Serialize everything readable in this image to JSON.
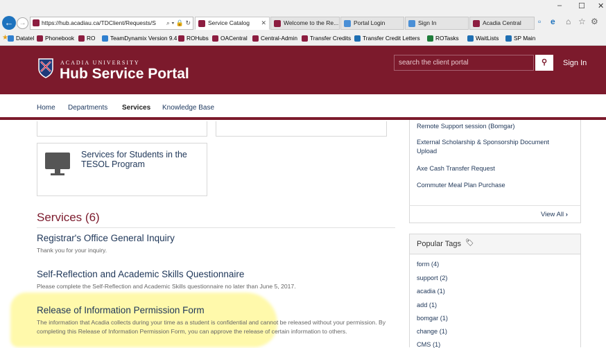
{
  "browser": {
    "url": "https://hub.acadiau.ca/TDClient/Requests/S",
    "tabs": [
      {
        "title": "Service Catalog",
        "icon_color": "#8c1d40",
        "active": true
      },
      {
        "title": "Welcome to the Re...",
        "icon_color": "#8c1d40"
      },
      {
        "title": "Portal Login",
        "icon_color": "#4a8fd6"
      },
      {
        "title": "Sign In",
        "icon_color": "#4a8fd6"
      },
      {
        "title": "Acadia Central",
        "icon_color": "#8c1d40"
      }
    ],
    "favorites": [
      {
        "label": "Datatel",
        "icon_color": "#2f7fcf"
      },
      {
        "label": "Phonebook",
        "icon_color": "#8c1d40"
      },
      {
        "label": "RO",
        "icon_color": "#8c1d40"
      },
      {
        "label": "TeamDynamix Version 9.4",
        "icon_color": "#2f7fcf"
      },
      {
        "label": "ROHubs",
        "icon_color": "#8c1d40"
      },
      {
        "label": "OACentral",
        "icon_color": "#8c1d40"
      },
      {
        "label": "Central-Admin",
        "icon_color": "#8c1d40"
      },
      {
        "label": "Transfer Credits",
        "icon_color": "#8c1d40"
      },
      {
        "label": "Transfer Credit Letters",
        "icon_color": "#1f6fb2"
      },
      {
        "label": "ROTasks",
        "icon_color": "#1e7c3a"
      },
      {
        "label": "WaitLists",
        "icon_color": "#1f6fb2"
      },
      {
        "label": "SP Main",
        "icon_color": "#1f6fb2"
      }
    ]
  },
  "header": {
    "logo_small": "ACADIA UNIVERSITY",
    "logo_big": "Hub Service Portal",
    "search_placeholder": "search the client portal",
    "signin": "Sign In",
    "brand_color": "#7c1a2c"
  },
  "nav": [
    "Home",
    "Departments",
    "Services",
    "Knowledge Base"
  ],
  "category_card": {
    "title": "Services for Students in the TESOL Program"
  },
  "services": {
    "heading": "Services (6)",
    "items": [
      {
        "title": "Registrar's Office General Inquiry",
        "desc": "Thank you for your inquiry."
      },
      {
        "title": "Self-Reflection and Academic Skills Questionnaire",
        "desc": "Please complete the Self-Reflection and Academic Skills questionnaire no later than June 5, 2017."
      },
      {
        "title": "Release of Information Permission Form",
        "desc": "The information that Acadia collects during your time as a student is confidential and cannot be released without your permission. By completing this Release of Information Permission Form, you can approve the release of certain information to others."
      }
    ]
  },
  "sidebar": {
    "popular": [
      "Remote Support session (Bomgar)",
      "External Scholarship & Sponsorship Document Upload",
      "Axe Cash Transfer Request",
      "Commuter Meal Plan Purchase"
    ],
    "view_all": "View All",
    "tags_title": "Popular Tags",
    "tags": [
      "form (4)",
      "support (2)",
      "acadia (1)",
      "add (1)",
      "bomgar (1)",
      "change (1)",
      "CMS (1)"
    ]
  }
}
